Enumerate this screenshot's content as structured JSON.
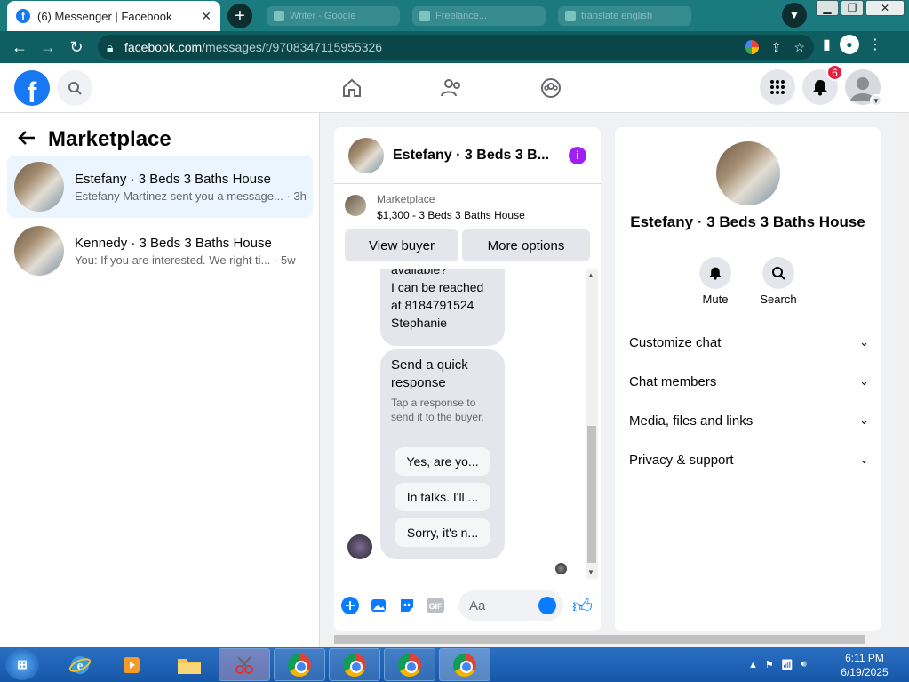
{
  "browser": {
    "active_tab_title": "(6) Messenger | Facebook",
    "faded_tabs": [
      "Writer - Google",
      "Freelance...",
      "translate english"
    ],
    "url_host": "facebook.com",
    "url_path": "/messages/t/9708347115955326"
  },
  "header": {
    "notifications_badge": "6"
  },
  "left": {
    "title": "Marketplace",
    "conversations": [
      {
        "name": "Estefany · 3 Beds 3 Baths House",
        "preview": "Estefany Martinez sent you a message...",
        "time": "· 3h"
      },
      {
        "name": "Kennedy · 3 Beds 3 Baths House",
        "preview": "You: If you are interested. We right ti...",
        "time": "· 5w"
      }
    ]
  },
  "chat": {
    "title": "Estefany · 3 Beds 3 B...",
    "product": {
      "source": "Marketplace",
      "price_line": "$1,300 - 3 Beds 3 Baths House",
      "view_buyer": "View buyer",
      "more_options": "More options"
    },
    "message_lines": [
      "available?",
      "I can be reached",
      "at 8184791524",
      "Stephanie"
    ],
    "quick": {
      "title": "Send a quick response",
      "subtitle": "Tap a response to send it to the buyer.",
      "replies": [
        "Yes, are yo...",
        "In talks. I'll ...",
        "Sorry, it's n..."
      ]
    },
    "composer": {
      "placeholder": "Aa",
      "gif_label": "GIF"
    }
  },
  "info_panel": {
    "name": "Estefany · 3 Beds 3 Baths House",
    "actions": [
      "Mute",
      "Search"
    ],
    "sections": [
      "Customize chat",
      "Chat members",
      "Media, files and links",
      "Privacy & support"
    ]
  },
  "taskbar": {
    "time": "6:11 PM",
    "date": "6/19/2025"
  }
}
